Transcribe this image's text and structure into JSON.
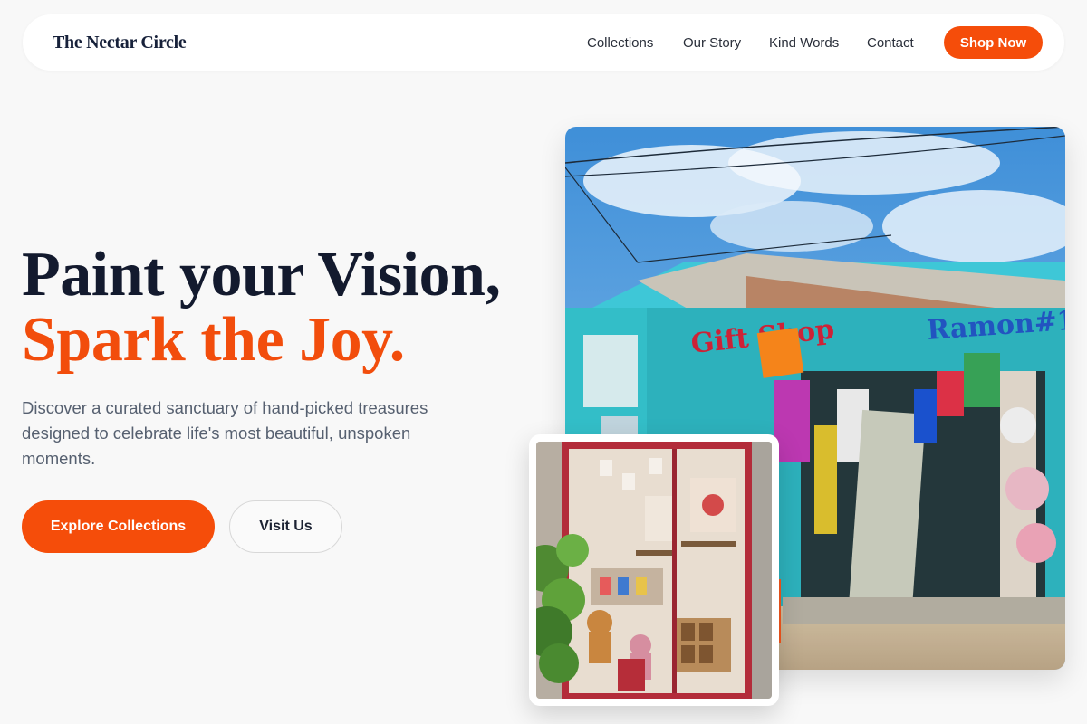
{
  "nav": {
    "brand": "The Nectar Circle",
    "links": [
      "Collections",
      "Our Story",
      "Kind Words",
      "Contact"
    ],
    "cta": "Shop Now"
  },
  "hero": {
    "headline_line1": "Paint your Vision,",
    "headline_line2": "Spark the Joy.",
    "lede": "Discover a curated sanctuary of hand-picked treasures designed to celebrate life's most beautiful, unspoken moments.",
    "primary_button": "Explore Collections",
    "secondary_button": "Visit Us"
  },
  "photos": {
    "main_alt": "Colorful turquoise gift shop storefront with hanging hats and souvenirs",
    "main_sign_1": "Gift Shop",
    "main_sign_2": "Ramon#1",
    "secondary_alt": "Boutique shop window display with toys and framed items"
  },
  "colors": {
    "accent": "#f54d0a",
    "headline": "#131a2e",
    "background": "#f8f8f8"
  }
}
